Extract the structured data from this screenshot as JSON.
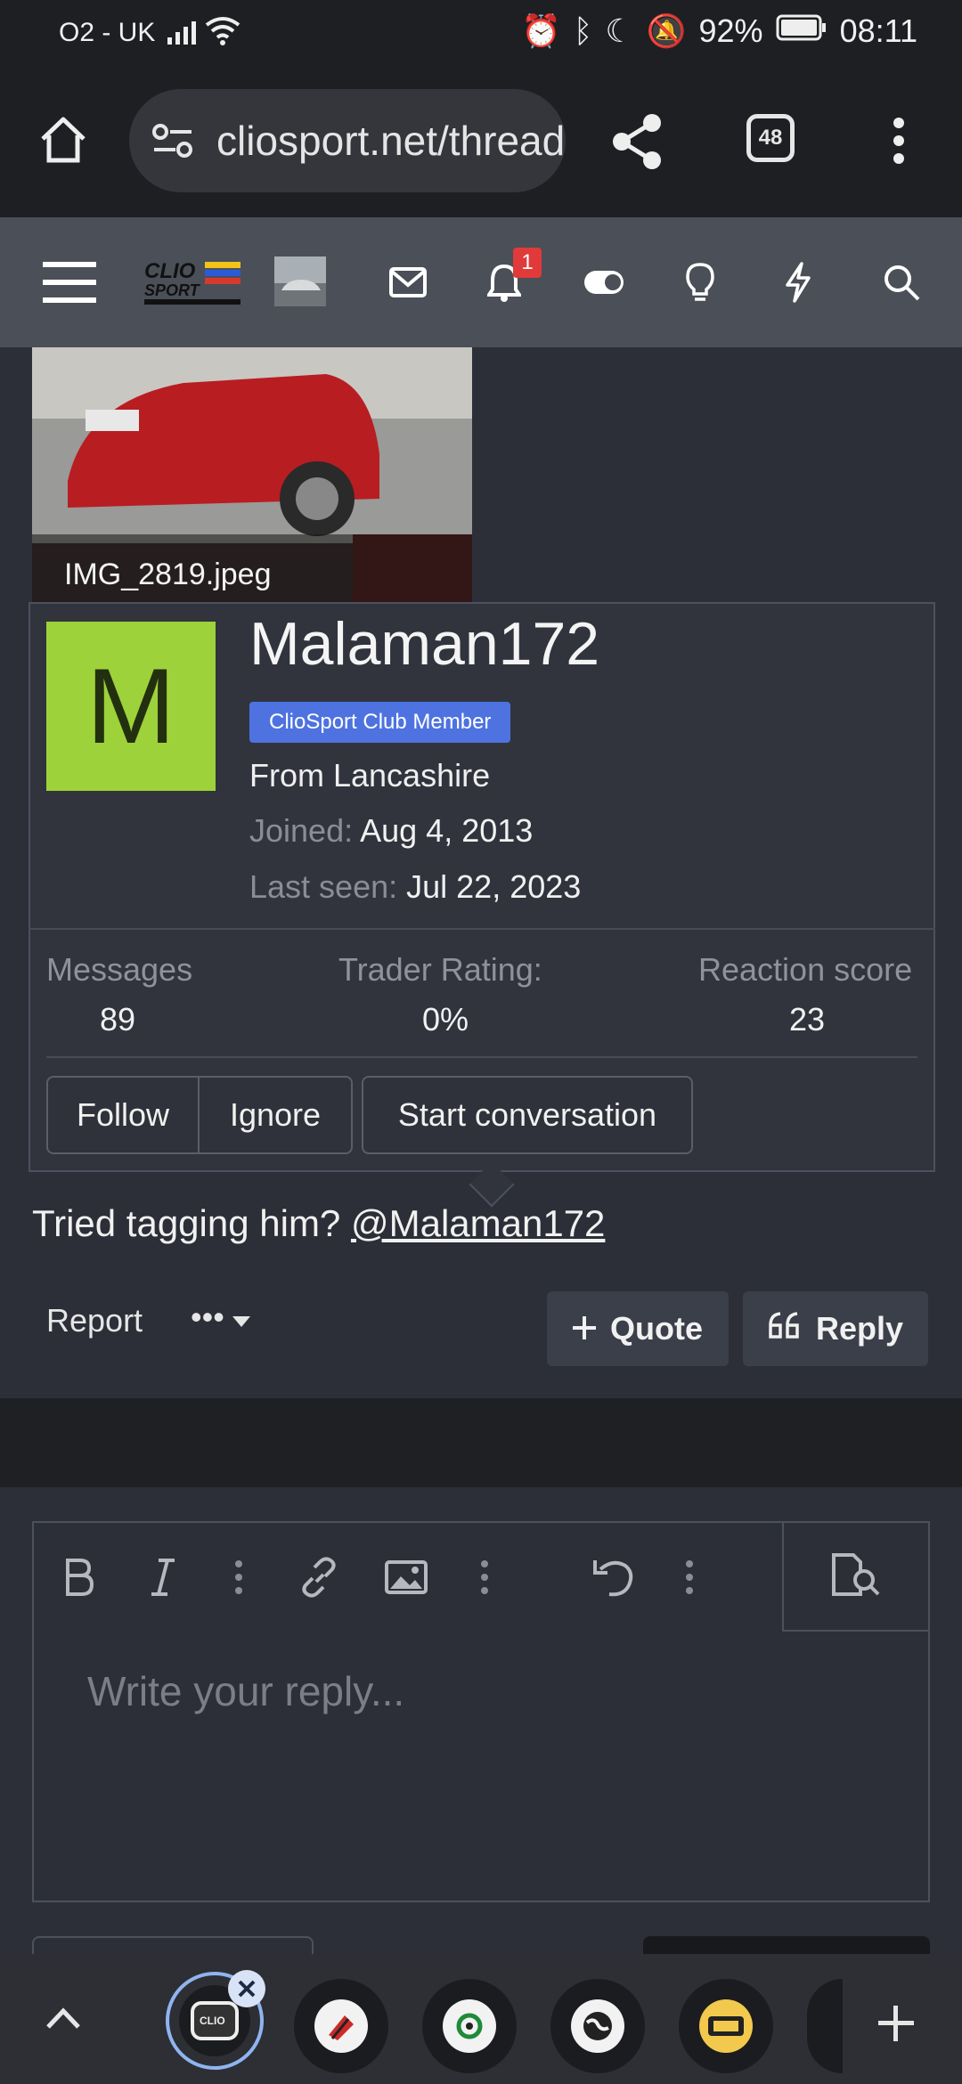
{
  "status_bar": {
    "carrier": "O2 - UK",
    "battery": "92%",
    "time": "08:11"
  },
  "browser": {
    "url": "cliosport.net/threads",
    "tab_count": "48"
  },
  "forum_nav": {
    "notification_count": "1"
  },
  "attachment": {
    "filename": "IMG_2819.jpeg"
  },
  "member_popup": {
    "avatar_letter": "M",
    "avatar_color": "#9ed23a",
    "username": "Malaman172",
    "badge": "ClioSport Club Member",
    "location": "From Lancashire",
    "joined_label": "Joined:",
    "joined_value": "Aug 4, 2013",
    "last_seen_label": "Last seen:",
    "last_seen_value": "Jul 22, 2023",
    "stats": [
      {
        "label": "Messages",
        "value": "89"
      },
      {
        "label": "Trader Rating:",
        "value": "0%"
      },
      {
        "label": "Reaction score",
        "value": "23"
      }
    ],
    "buttons": {
      "follow": "Follow",
      "ignore": "Ignore",
      "start_conversation": "Start conversation"
    }
  },
  "post": {
    "text": "Tried tagging him? ",
    "mention": "@Malaman172",
    "report": "Report",
    "more": "•••",
    "quote": "Quote",
    "reply": "Reply"
  },
  "editor": {
    "placeholder": "Write your reply..."
  }
}
